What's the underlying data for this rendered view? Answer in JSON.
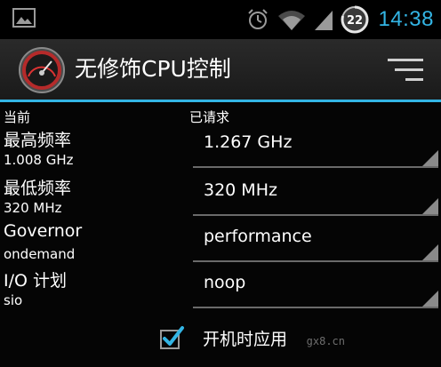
{
  "status_bar": {
    "time": "14:38",
    "battery_level": "22",
    "icons": [
      "picture-icon",
      "alarm-icon",
      "wifi-icon",
      "signal-icon",
      "battery-icon"
    ]
  },
  "app": {
    "title": "无修饰CPU控制",
    "icon": "speedometer-icon",
    "menu_icon": "menu-icon"
  },
  "columns": {
    "current": "当前",
    "requested": "已请求"
  },
  "rows": [
    {
      "label": "最高频率",
      "current": "1.008 GHz",
      "requested": "1.267 GHz"
    },
    {
      "label": "最低频率",
      "current": "320 MHz",
      "requested": "320 MHz"
    },
    {
      "label": "Governor",
      "current": "ondemand",
      "requested": "performance"
    },
    {
      "label": "I/O 计划",
      "current": "sio",
      "requested": "noop"
    }
  ],
  "apply_on_boot": {
    "label": "开机时应用",
    "checked": true
  },
  "watermark": "gx8.cn",
  "colors": {
    "accent": "#33b5e5",
    "background": "#000000",
    "actionbar": "#222222",
    "text": "#ffffff"
  }
}
